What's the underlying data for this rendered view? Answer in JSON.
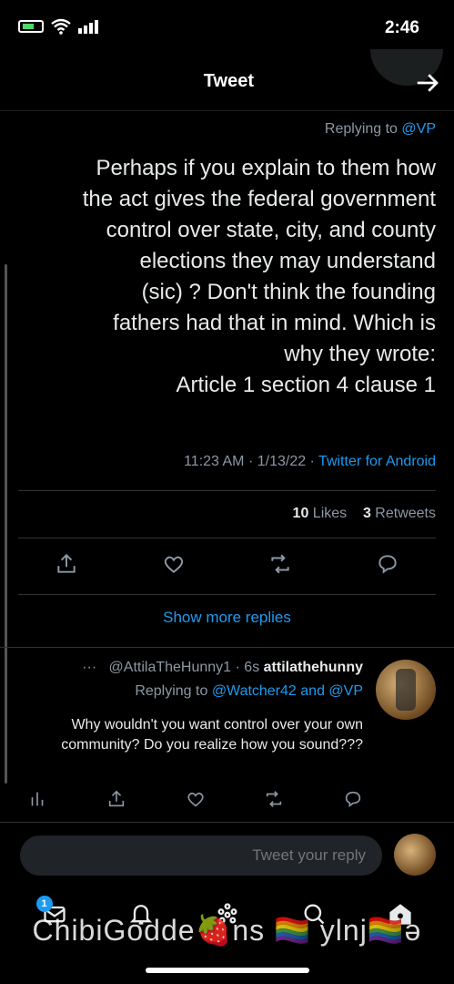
{
  "status_bar": {
    "time": "2:46"
  },
  "header": {
    "title": "Tweet"
  },
  "tweet": {
    "replying_prefix": "Replying to",
    "replying_to": "@VP",
    "text": "Perhaps if you explain to them how\nthe act gives the federal government\ncontrol over state, city, and county\nelections they may understand\n(sic) ? Don't think the founding\nfathers had that in mind. Which is\nwhy they wrote:\nArticle 1 section 4 clause 1",
    "timestamp": "11:23 AM · 1/13/22 ·",
    "source": "Twitter for Android",
    "retweets_count": "3",
    "retweets_label": "Retweets",
    "likes_count": "10",
    "likes_label": "Likes"
  },
  "show_more_replies": "Show more replies",
  "reply": {
    "display_name": "attilathehunny",
    "handle_time": "@AttilaTheHunny1 · 6s",
    "more": "···",
    "replying_prefix": "Replying to",
    "replying_to": "@Watcher42 and @VP",
    "text": "Why wouldn't you want control over your own community? Do you realize how you sound???"
  },
  "compose": {
    "placeholder": "Tweet your reply"
  },
  "nav": {
    "messages_badge": "1"
  },
  "watermark": "ChibiGodde🍓ns 🏳️‍🌈 ylnj🏳️‍🌈ǝ",
  "icons": [
    "back-arrow-icon",
    "share-icon",
    "like-icon",
    "retweet-icon",
    "reply-icon",
    "analytics-icon",
    "home-icon",
    "spaces-icon",
    "search-icon",
    "notifications-icon",
    "messages-icon"
  ],
  "colors": {
    "accent": "#1d9bf0",
    "background": "#000000",
    "muted": "#8b98a5"
  }
}
